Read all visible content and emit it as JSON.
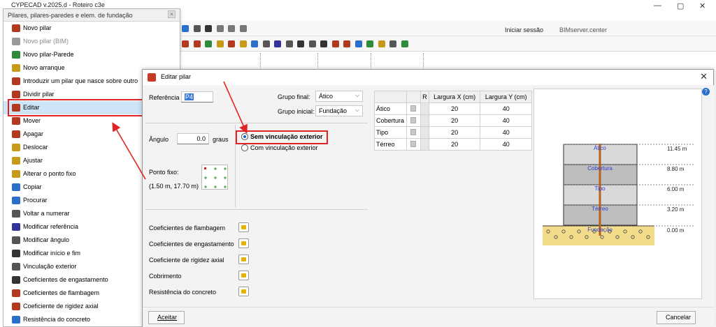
{
  "app": {
    "title": "CYPECAD v.2025.d - Roteiro c3e"
  },
  "window_controls": {
    "minimize": "—",
    "restore": "▢",
    "close": "✕"
  },
  "topbar": {
    "login": "Iniciar sessão",
    "bimserver": "BIMserver.center"
  },
  "menu": {
    "title": "Pilares, pilares-paredes e elem. de fundação",
    "items": [
      {
        "label": "Novo pilar",
        "icon": "new-column-icon",
        "color": "#b33a1f",
        "disabled": false
      },
      {
        "label": "Novo pilar (BIM)",
        "icon": "new-column-bim-icon",
        "color": "#9a9a9a",
        "disabled": true
      },
      {
        "label": "Novo pilar-Parede",
        "icon": "new-wall-column-icon",
        "color": "#2e8b3a",
        "disabled": false
      },
      {
        "label": "Novo arranque",
        "icon": "new-start-icon",
        "color": "#c79a1a",
        "disabled": false
      },
      {
        "label": "Introduzir um pilar que nasce sobre outro",
        "icon": "column-on-column-icon",
        "color": "#b33a1f",
        "disabled": false
      },
      {
        "label": "Dividir pilar",
        "icon": "split-column-icon",
        "color": "#b33a1f",
        "disabled": false
      },
      {
        "label": "Editar",
        "icon": "edit-column-icon",
        "color": "#b33a1f",
        "disabled": false,
        "active": true
      },
      {
        "label": "Mover",
        "icon": "move-icon",
        "color": "#b33a1f",
        "disabled": false
      },
      {
        "label": "Apagar",
        "icon": "delete-icon",
        "color": "#b33a1f",
        "disabled": false
      },
      {
        "label": "Deslocar",
        "icon": "shift-icon",
        "color": "#c79a1a",
        "disabled": false
      },
      {
        "label": "Ajustar",
        "icon": "adjust-icon",
        "color": "#c79a1a",
        "disabled": false
      },
      {
        "label": "Alterar o ponto fixo",
        "icon": "fixed-point-icon",
        "color": "#c79a1a",
        "disabled": false
      },
      {
        "label": "Copiar",
        "icon": "copy-icon",
        "color": "#2a6fc9",
        "disabled": false
      },
      {
        "label": "Procurar",
        "icon": "search-icon",
        "color": "#2a6fc9",
        "disabled": false
      },
      {
        "label": "Voltar a numerar",
        "icon": "renumber-icon",
        "color": "#555555",
        "disabled": false
      },
      {
        "label": "Modificar referência",
        "icon": "modify-reference-icon",
        "color": "#333399",
        "disabled": false
      },
      {
        "label": "Modificar ângulo",
        "icon": "modify-angle-icon",
        "color": "#555555",
        "disabled": false
      },
      {
        "label": "Modificar início e fim",
        "icon": "modify-start-end-icon",
        "color": "#333333",
        "disabled": false
      },
      {
        "label": "Vinculação exterior",
        "icon": "external-link-icon",
        "color": "#555555",
        "disabled": false
      },
      {
        "label": "Coeficientes de engastamento",
        "icon": "fixity-coef-icon",
        "color": "#333333",
        "disabled": false
      },
      {
        "label": "Coeficientes de flambagem",
        "icon": "buckling-coef-icon",
        "color": "#b33a1f",
        "disabled": false
      },
      {
        "label": "Coeficiente de rigidez axial",
        "icon": "axial-stiffness-icon",
        "color": "#b33a1f",
        "disabled": false
      },
      {
        "label": "Resistência do concreto",
        "icon": "concrete-strength-icon",
        "color": "#2a6fc9",
        "disabled": false
      }
    ]
  },
  "dialog": {
    "title": "Editar pilar",
    "referencia_label": "Referência",
    "referencia_value": "P4",
    "grupo_final_label": "Grupo final:",
    "grupo_final_value": "Ático",
    "grupo_inicial_label": "Grupo inicial:",
    "grupo_inicial_value": "Fundação",
    "angulo_label": "Ângulo",
    "angulo_value": "0.0",
    "angulo_unit": "graus",
    "radio_sem": "Sem vinculação exterior",
    "radio_com": "Com vinculação exterior",
    "ponto_fixo_label": "Ponto fixo:",
    "ponto_fixo_value": "(1.50 m, 17.70 m)",
    "coefs": [
      "Coeficientes de flambagem",
      "Coeficientes de engastamento",
      "Coeficiente de rigidez axial",
      "Cobrimento",
      "Resistência do concreto"
    ],
    "table": {
      "headers": [
        "",
        "",
        "R",
        "Largura X (cm)",
        "Largura Y (cm)"
      ],
      "rows": [
        {
          "name": "Ático",
          "x": "20",
          "y": "40"
        },
        {
          "name": "Cobertura",
          "x": "20",
          "y": "40"
        },
        {
          "name": "Tipo",
          "x": "20",
          "y": "40"
        },
        {
          "name": "Térreo",
          "x": "20",
          "y": "40"
        }
      ]
    },
    "preview": {
      "levels": [
        {
          "name": "Ático",
          "elev": "11.45 m"
        },
        {
          "name": "Cobertura",
          "elev": "8.80 m"
        },
        {
          "name": "Tipo",
          "elev": "6.00 m"
        },
        {
          "name": "Térreo",
          "elev": "3.20 m"
        },
        {
          "name": "Fundação",
          "elev": "0.00 m"
        }
      ]
    },
    "accept_label": "Aceitar",
    "cancel_label": "Cancelar",
    "help": "?"
  },
  "colors": {
    "highlight": "#e02424",
    "column": "#b8601e",
    "floor_dark": "#bdbdbd",
    "floor_light": "#d9d9d9",
    "soil": "#f3dc8a"
  }
}
